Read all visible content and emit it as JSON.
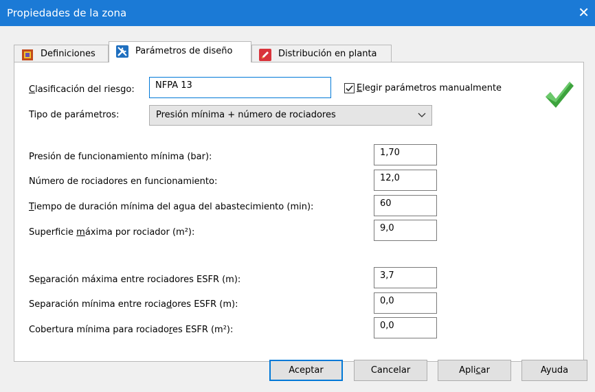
{
  "window": {
    "title": "Propiedades de la zona"
  },
  "tabs": [
    {
      "label": "Definiciones",
      "icon": "definitions-icon"
    },
    {
      "label": "Parámetros de diseño",
      "icon": "tools-icon"
    },
    {
      "label": "Distribución en planta",
      "icon": "pencil-icon"
    }
  ],
  "form": {
    "risk_label_pre": "",
    "risk_label_u": "C",
    "risk_label_post": "lasificación del riesgo:",
    "risk_value": "NFPA 13",
    "manual_label_u": "E",
    "manual_label_post": "legir parámetros manualmente",
    "manual_checked": true,
    "param_type_label": "Tipo de parámetros:",
    "param_type_value": "Presión mínima + número de rociadores",
    "fields": [
      {
        "pre": "Presión de funcionamiento mínima (bar):",
        "u": "",
        "post": "",
        "value": "1,70"
      },
      {
        "pre": "Número de rociadores en funcionamiento:",
        "u": "",
        "post": "",
        "value": "12,0"
      },
      {
        "pre": "",
        "u": "T",
        "post": "iempo de duración mínima del agua del abastecimiento (min):",
        "value": "60"
      },
      {
        "pre": "Superficie ",
        "u": "m",
        "post": "áxima por rociador (m²):",
        "value": "9,0"
      },
      {
        "pre": "Se",
        "u": "p",
        "post": "aración máxima entre rociadores ESFR (m):",
        "value": "3,7"
      },
      {
        "pre": "Separación mínima entre rocia",
        "u": "d",
        "post": "ores ESFR (m):",
        "value": "0,0"
      },
      {
        "pre": "Cobertura mínima para rociado",
        "u": "r",
        "post": "es ESFR (m²):",
        "value": "0,0"
      }
    ]
  },
  "buttons": {
    "accept": "Aceptar",
    "cancel": "Cancelar",
    "apply_pre": "Apli",
    "apply_u": "c",
    "apply_post": "ar",
    "help": "Ayuda"
  },
  "colors": {
    "titlebar": "#1b7ad6",
    "check": "#3da33d",
    "focus": "#0078d7"
  }
}
